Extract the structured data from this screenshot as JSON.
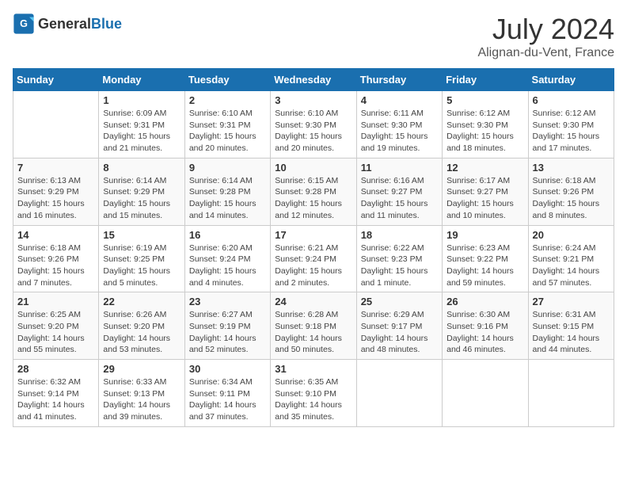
{
  "header": {
    "logo_general": "General",
    "logo_blue": "Blue",
    "month": "July 2024",
    "location": "Alignan-du-Vent, France"
  },
  "weekdays": [
    "Sunday",
    "Monday",
    "Tuesday",
    "Wednesday",
    "Thursday",
    "Friday",
    "Saturday"
  ],
  "weeks": [
    [
      {
        "day": "",
        "sunrise": "",
        "sunset": "",
        "daylight": ""
      },
      {
        "day": "1",
        "sunrise": "Sunrise: 6:09 AM",
        "sunset": "Sunset: 9:31 PM",
        "daylight": "Daylight: 15 hours and 21 minutes."
      },
      {
        "day": "2",
        "sunrise": "Sunrise: 6:10 AM",
        "sunset": "Sunset: 9:31 PM",
        "daylight": "Daylight: 15 hours and 20 minutes."
      },
      {
        "day": "3",
        "sunrise": "Sunrise: 6:10 AM",
        "sunset": "Sunset: 9:30 PM",
        "daylight": "Daylight: 15 hours and 20 minutes."
      },
      {
        "day": "4",
        "sunrise": "Sunrise: 6:11 AM",
        "sunset": "Sunset: 9:30 PM",
        "daylight": "Daylight: 15 hours and 19 minutes."
      },
      {
        "day": "5",
        "sunrise": "Sunrise: 6:12 AM",
        "sunset": "Sunset: 9:30 PM",
        "daylight": "Daylight: 15 hours and 18 minutes."
      },
      {
        "day": "6",
        "sunrise": "Sunrise: 6:12 AM",
        "sunset": "Sunset: 9:30 PM",
        "daylight": "Daylight: 15 hours and 17 minutes."
      }
    ],
    [
      {
        "day": "7",
        "sunrise": "Sunrise: 6:13 AM",
        "sunset": "Sunset: 9:29 PM",
        "daylight": "Daylight: 15 hours and 16 minutes."
      },
      {
        "day": "8",
        "sunrise": "Sunrise: 6:14 AM",
        "sunset": "Sunset: 9:29 PM",
        "daylight": "Daylight: 15 hours and 15 minutes."
      },
      {
        "day": "9",
        "sunrise": "Sunrise: 6:14 AM",
        "sunset": "Sunset: 9:28 PM",
        "daylight": "Daylight: 15 hours and 14 minutes."
      },
      {
        "day": "10",
        "sunrise": "Sunrise: 6:15 AM",
        "sunset": "Sunset: 9:28 PM",
        "daylight": "Daylight: 15 hours and 12 minutes."
      },
      {
        "day": "11",
        "sunrise": "Sunrise: 6:16 AM",
        "sunset": "Sunset: 9:27 PM",
        "daylight": "Daylight: 15 hours and 11 minutes."
      },
      {
        "day": "12",
        "sunrise": "Sunrise: 6:17 AM",
        "sunset": "Sunset: 9:27 PM",
        "daylight": "Daylight: 15 hours and 10 minutes."
      },
      {
        "day": "13",
        "sunrise": "Sunrise: 6:18 AM",
        "sunset": "Sunset: 9:26 PM",
        "daylight": "Daylight: 15 hours and 8 minutes."
      }
    ],
    [
      {
        "day": "14",
        "sunrise": "Sunrise: 6:18 AM",
        "sunset": "Sunset: 9:26 PM",
        "daylight": "Daylight: 15 hours and 7 minutes."
      },
      {
        "day": "15",
        "sunrise": "Sunrise: 6:19 AM",
        "sunset": "Sunset: 9:25 PM",
        "daylight": "Daylight: 15 hours and 5 minutes."
      },
      {
        "day": "16",
        "sunrise": "Sunrise: 6:20 AM",
        "sunset": "Sunset: 9:24 PM",
        "daylight": "Daylight: 15 hours and 4 minutes."
      },
      {
        "day": "17",
        "sunrise": "Sunrise: 6:21 AM",
        "sunset": "Sunset: 9:24 PM",
        "daylight": "Daylight: 15 hours and 2 minutes."
      },
      {
        "day": "18",
        "sunrise": "Sunrise: 6:22 AM",
        "sunset": "Sunset: 9:23 PM",
        "daylight": "Daylight: 15 hours and 1 minute."
      },
      {
        "day": "19",
        "sunrise": "Sunrise: 6:23 AM",
        "sunset": "Sunset: 9:22 PM",
        "daylight": "Daylight: 14 hours and 59 minutes."
      },
      {
        "day": "20",
        "sunrise": "Sunrise: 6:24 AM",
        "sunset": "Sunset: 9:21 PM",
        "daylight": "Daylight: 14 hours and 57 minutes."
      }
    ],
    [
      {
        "day": "21",
        "sunrise": "Sunrise: 6:25 AM",
        "sunset": "Sunset: 9:20 PM",
        "daylight": "Daylight: 14 hours and 55 minutes."
      },
      {
        "day": "22",
        "sunrise": "Sunrise: 6:26 AM",
        "sunset": "Sunset: 9:20 PM",
        "daylight": "Daylight: 14 hours and 53 minutes."
      },
      {
        "day": "23",
        "sunrise": "Sunrise: 6:27 AM",
        "sunset": "Sunset: 9:19 PM",
        "daylight": "Daylight: 14 hours and 52 minutes."
      },
      {
        "day": "24",
        "sunrise": "Sunrise: 6:28 AM",
        "sunset": "Sunset: 9:18 PM",
        "daylight": "Daylight: 14 hours and 50 minutes."
      },
      {
        "day": "25",
        "sunrise": "Sunrise: 6:29 AM",
        "sunset": "Sunset: 9:17 PM",
        "daylight": "Daylight: 14 hours and 48 minutes."
      },
      {
        "day": "26",
        "sunrise": "Sunrise: 6:30 AM",
        "sunset": "Sunset: 9:16 PM",
        "daylight": "Daylight: 14 hours and 46 minutes."
      },
      {
        "day": "27",
        "sunrise": "Sunrise: 6:31 AM",
        "sunset": "Sunset: 9:15 PM",
        "daylight": "Daylight: 14 hours and 44 minutes."
      }
    ],
    [
      {
        "day": "28",
        "sunrise": "Sunrise: 6:32 AM",
        "sunset": "Sunset: 9:14 PM",
        "daylight": "Daylight: 14 hours and 41 minutes."
      },
      {
        "day": "29",
        "sunrise": "Sunrise: 6:33 AM",
        "sunset": "Sunset: 9:13 PM",
        "daylight": "Daylight: 14 hours and 39 minutes."
      },
      {
        "day": "30",
        "sunrise": "Sunrise: 6:34 AM",
        "sunset": "Sunset: 9:11 PM",
        "daylight": "Daylight: 14 hours and 37 minutes."
      },
      {
        "day": "31",
        "sunrise": "Sunrise: 6:35 AM",
        "sunset": "Sunset: 9:10 PM",
        "daylight": "Daylight: 14 hours and 35 minutes."
      },
      {
        "day": "",
        "sunrise": "",
        "sunset": "",
        "daylight": ""
      },
      {
        "day": "",
        "sunrise": "",
        "sunset": "",
        "daylight": ""
      },
      {
        "day": "",
        "sunrise": "",
        "sunset": "",
        "daylight": ""
      }
    ]
  ]
}
